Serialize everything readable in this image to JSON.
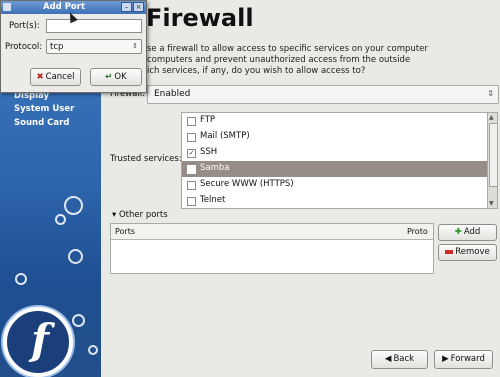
{
  "sidebar": {
    "items": [
      "Display",
      "System User",
      "Sound Card"
    ]
  },
  "main": {
    "title": "Firewall",
    "intro_lines": [
      "se a firewall to allow access to specific services on your computer",
      "computers and prevent unauthorized access from the outside",
      "ich services, if any, do you wish to allow access to?"
    ],
    "firewall_label": "Firewall:",
    "firewall_value": "Enabled",
    "trusted_label": "Trusted services:",
    "services": [
      {
        "label": "FTP",
        "checked": false,
        "selected": false
      },
      {
        "label": "Mail (SMTP)",
        "checked": false,
        "selected": false
      },
      {
        "label": "SSH",
        "checked": true,
        "selected": false
      },
      {
        "label": "Samba",
        "checked": false,
        "selected": true
      },
      {
        "label": "Secure WWW (HTTPS)",
        "checked": false,
        "selected": false
      },
      {
        "label": "Telnet",
        "checked": false,
        "selected": false
      }
    ],
    "other_ports_label": "Other ports",
    "ports_columns": [
      "Ports",
      "Proto"
    ],
    "add_label": "Add",
    "remove_label": "Remove",
    "back_label": "Back",
    "forward_label": "Forward"
  },
  "dialog": {
    "title": "Add Port",
    "port_label": "Port(s):",
    "port_value": "",
    "protocol_label": "Protocol:",
    "protocol_value": "tcp",
    "cancel_label": "Cancel",
    "ok_label": "OK"
  },
  "colors": {
    "sidebar": "#2f67ae",
    "selection": "#968d87",
    "titlebar": "#3f70b6"
  }
}
